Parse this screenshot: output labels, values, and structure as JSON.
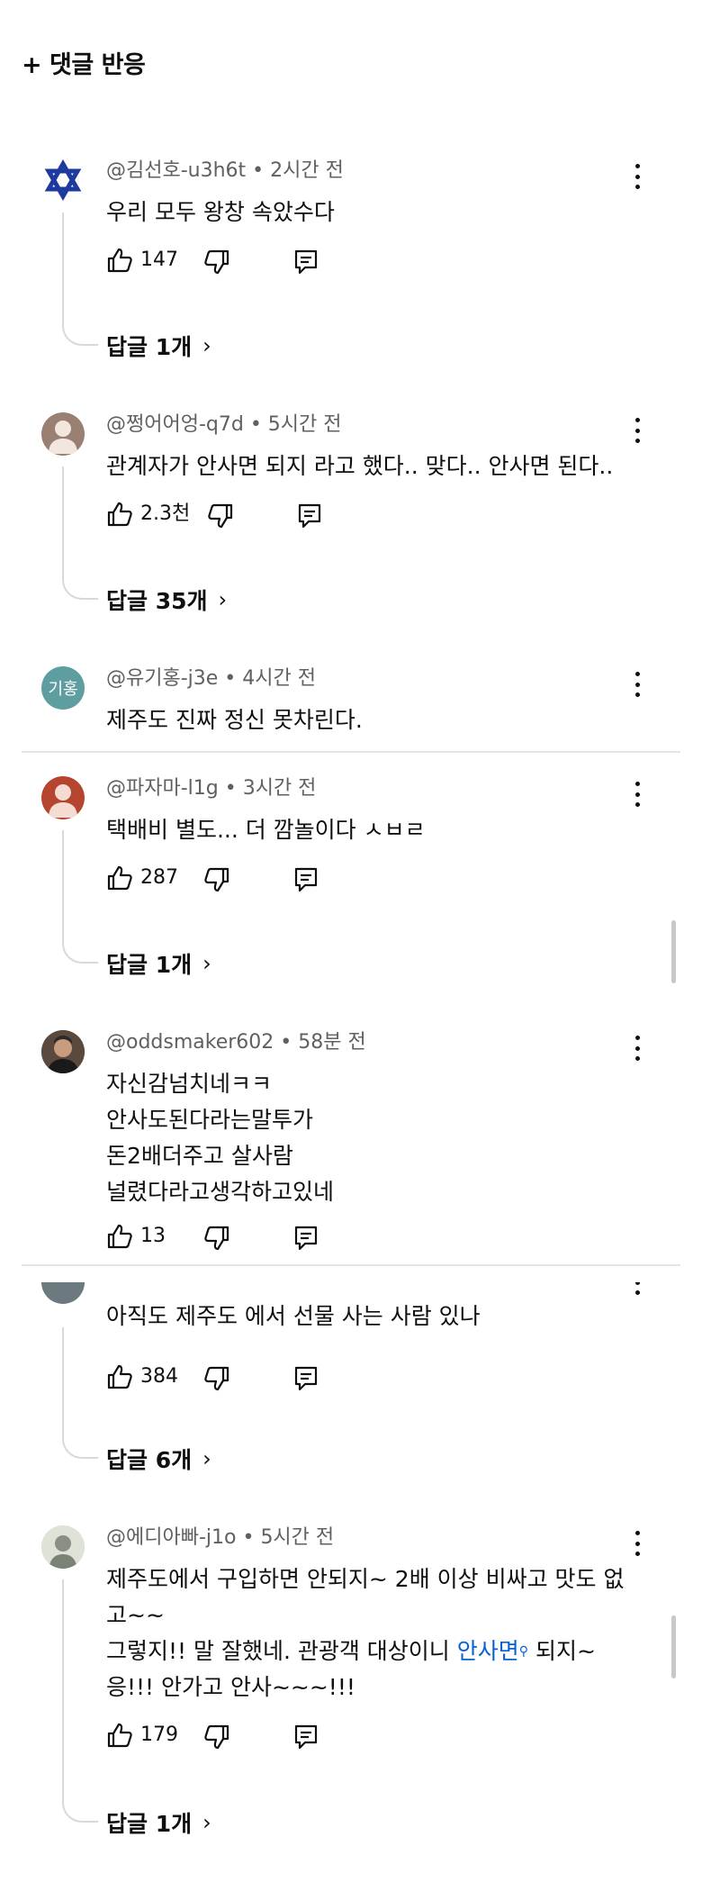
{
  "header": {
    "title": "+ 댓글 반응"
  },
  "comments": [
    {
      "author": "@김선호-u3h6t",
      "time": "2시간 전",
      "lines": [
        "우리 모두 왕창 속았수다"
      ],
      "likes": "147",
      "replies": "답글 1개"
    },
    {
      "author": "@쩡어어엉-q7d",
      "time": "5시간 전",
      "lines": [
        "관계자가 안사면 되지 라고 했다..  맞다.. 안사면 된다.."
      ],
      "likes": "2.3천",
      "replies": "답글 35개"
    },
    {
      "author": "@유기홍-j3e",
      "time": "4시간 전",
      "avatar_text": "기홍",
      "lines": [
        "제주도 진짜 정신 못차린다."
      ]
    },
    {
      "author": "@파자마-l1g",
      "time": "3시간 전",
      "lines": [
        "택배비 별도...  더 깜놀이다 ㅅㅂㄹ"
      ],
      "likes": "287",
      "replies": "답글 1개"
    },
    {
      "author": "@oddsmaker602",
      "time": "58분 전",
      "lines": [
        "자신감넘치네ㅋㅋ",
        "안사도된다라는말투가",
        "돈2배더주고 살사람",
        "널렸다라고생각하고있네"
      ],
      "likes": "13"
    },
    {
      "lines": [
        "아직도 제주도 에서  선물 사는 사람  있나"
      ],
      "likes": "384",
      "replies": "답글 6개"
    },
    {
      "author": "@에디아빠-j1o",
      "time": "5시간 전",
      "line1": "제주도에서 구입하면 안되지~ 2배 이상 비싸고 맛도 없",
      "line2": "고~~",
      "line3_pre": "그렇지!! 말 잘했네. 관광객 대상이니 ",
      "line3_link": "안사면",
      "line3_post": " 되지~",
      "line4": "응!!! 안가고 안사~~~!!!",
      "likes": "179",
      "replies": "답글 1개"
    }
  ],
  "icons": {
    "like": "thumbs-up-icon",
    "dislike": "thumbs-down-icon",
    "reply": "reply-icon",
    "more": "more-vert-icon",
    "chevron": "chevron-right-icon"
  },
  "colors": {
    "meta": "#606060",
    "link": "#065fd4",
    "divider": "#e5e5e5"
  }
}
